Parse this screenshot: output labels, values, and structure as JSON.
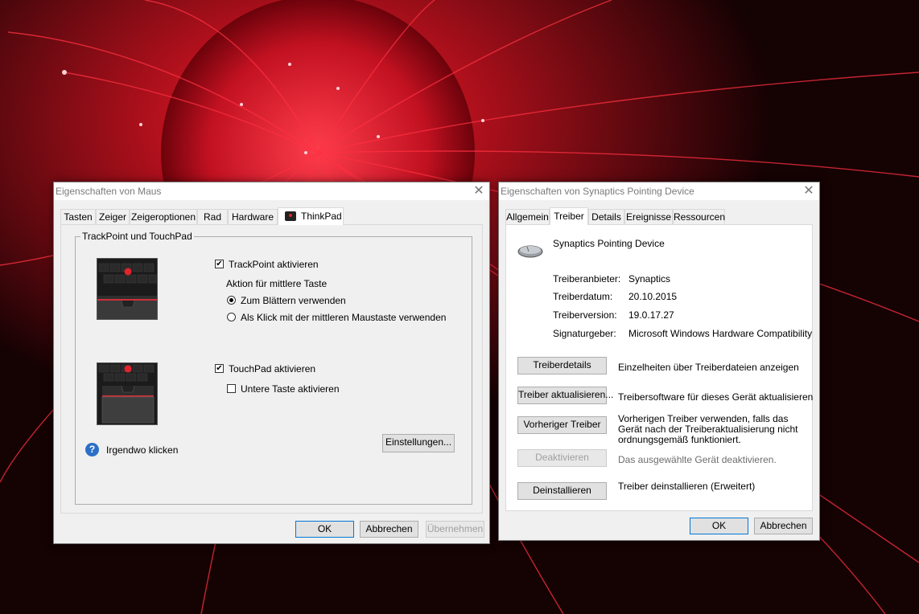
{
  "mouse_window": {
    "title": "Eigenschaften von Maus",
    "tabs": [
      "Tasten",
      "Zeiger",
      "Zeigeroptionen",
      "Rad",
      "Hardware",
      "ThinkPad"
    ],
    "active_tab": "ThinkPad",
    "group_title": "TrackPoint und TouchPad",
    "trackpoint_checkbox": "TrackPoint aktivieren",
    "trackpoint_checked": true,
    "middle_button_label": "Aktion für mittlere Taste",
    "radio_scroll": "Zum Blättern verwenden",
    "radio_scroll_selected": true,
    "radio_click": "Als Klick mit der mittleren Maustaste verwenden",
    "touchpad_checkbox": "TouchPad aktivieren",
    "touchpad_checked": true,
    "lower_button_checkbox": "Untere Taste aktivieren",
    "lower_button_checked": false,
    "help_link": "Irgendwo klicken",
    "settings_button": "Einstellungen...",
    "ok": "OK",
    "cancel": "Abbrechen",
    "apply": "Übernehmen"
  },
  "device_window": {
    "title": "Eigenschaften von Synaptics Pointing Device",
    "tabs": [
      "Allgemein",
      "Treiber",
      "Details",
      "Ereignisse",
      "Ressourcen"
    ],
    "active_tab": "Treiber",
    "device_name": "Synaptics Pointing Device",
    "info": [
      {
        "label": "Treiberanbieter:",
        "value": "Synaptics"
      },
      {
        "label": "Treiberdatum:",
        "value": "20.10.2015"
      },
      {
        "label": "Treiberversion:",
        "value": "19.0.17.27"
      },
      {
        "label": "Signaturgeber:",
        "value": "Microsoft Windows Hardware Compatibility"
      }
    ],
    "actions": [
      {
        "button": "Treiberdetails",
        "desc": "Einzelheiten über Treiberdateien anzeigen",
        "enabled": true
      },
      {
        "button": "Treiber aktualisieren...",
        "desc": "Treibersoftware für dieses Gerät aktualisieren",
        "enabled": true
      },
      {
        "button": "Vorheriger Treiber",
        "desc": "Vorherigen Treiber verwenden, falls das Gerät nach der Treiberaktualisierung nicht ordnungsgemäß funktioniert.",
        "enabled": true
      },
      {
        "button": "Deaktivieren",
        "desc": "Das ausgewählte Gerät deaktivieren.",
        "enabled": false
      },
      {
        "button": "Deinstallieren",
        "desc": "Treiber deinstallieren (Erweitert)",
        "enabled": true
      }
    ],
    "ok": "OK",
    "cancel": "Abbrechen"
  },
  "icons": {
    "close": "close-icon",
    "help": "help-icon",
    "thinkpad_tab": "thinkpad-tab-icon",
    "mouse_device": "mouse-device-icon"
  },
  "colors": {
    "accent": "#0078d7",
    "trackpoint_red": "#e0242c",
    "wallpaper_red": "#c0101a"
  }
}
